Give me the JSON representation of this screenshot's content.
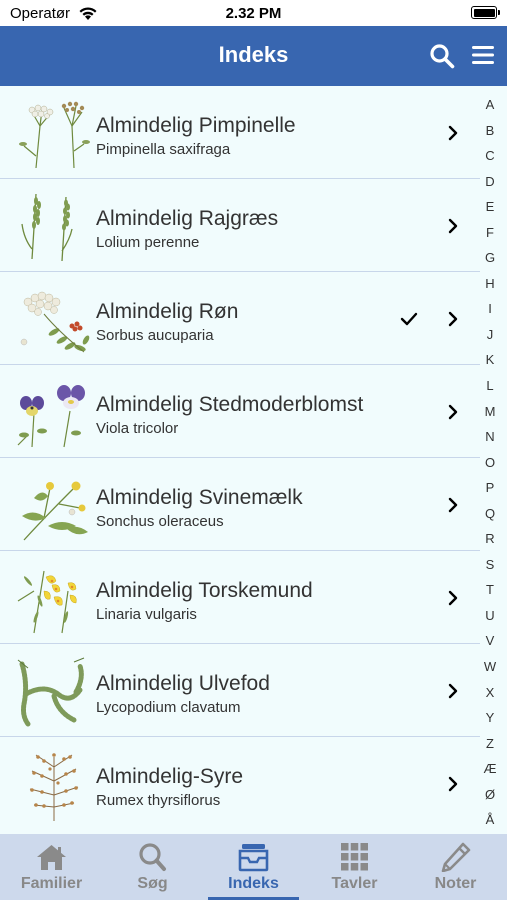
{
  "status": {
    "carrier": "Operatør",
    "time": "2.32 PM"
  },
  "header": {
    "title": "Indeks"
  },
  "rows": [
    {
      "title": "Almindelig Pimpinelle",
      "subtitle": "Pimpinella saxifraga",
      "checked": false
    },
    {
      "title": "Almindelig Rajgræs",
      "subtitle": "Lolium perenne",
      "checked": false
    },
    {
      "title": "Almindelig Røn",
      "subtitle": "Sorbus aucuparia",
      "checked": true
    },
    {
      "title": "Almindelig Stedmoderblomst",
      "subtitle": "Viola tricolor",
      "checked": false
    },
    {
      "title": "Almindelig Svinemælk",
      "subtitle": "Sonchus oleraceus",
      "checked": false
    },
    {
      "title": "Almindelig Torskemund",
      "subtitle": "Linaria vulgaris",
      "checked": false
    },
    {
      "title": "Almindelig Ulvefod",
      "subtitle": "Lycopodium clavatum",
      "checked": false
    },
    {
      "title": "Almindelig-Syre",
      "subtitle": "Rumex thyrsiflorus",
      "checked": false
    }
  ],
  "alphabet": [
    "A",
    "B",
    "C",
    "D",
    "E",
    "F",
    "G",
    "H",
    "I",
    "J",
    "K",
    "L",
    "M",
    "N",
    "O",
    "P",
    "Q",
    "R",
    "S",
    "T",
    "U",
    "V",
    "W",
    "X",
    "Y",
    "Z",
    "Æ",
    "Ø",
    "Å"
  ],
  "tabs": [
    {
      "label": "Familier",
      "icon": "home-icon",
      "active": false
    },
    {
      "label": "Søg",
      "icon": "search-icon",
      "active": false
    },
    {
      "label": "Indeks",
      "icon": "archive-box-icon",
      "active": true
    },
    {
      "label": "Tavler",
      "icon": "grid-icon",
      "active": false
    },
    {
      "label": "Noter",
      "icon": "pencil-icon",
      "active": false
    }
  ],
  "colors": {
    "nav_bar": "#3866b0",
    "list_background": "#f1fcfd",
    "tab_bar": "#cdd9ec",
    "active_tab": "#3866b0",
    "inactive_tab": "#888888"
  }
}
